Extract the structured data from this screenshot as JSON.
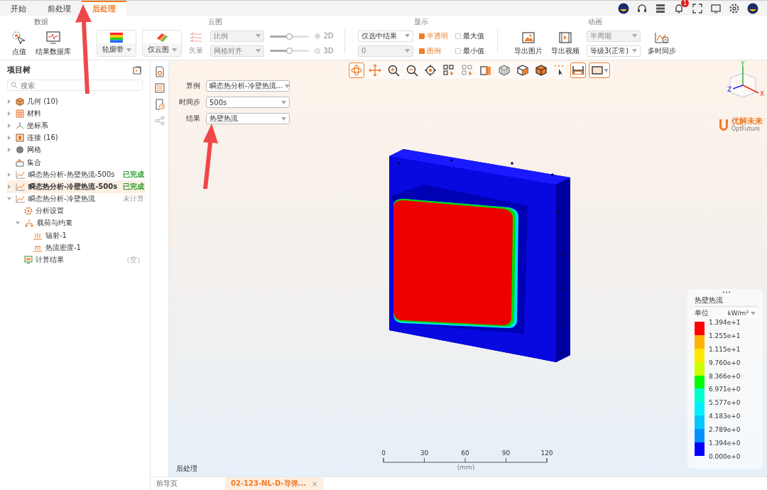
{
  "top_tabs": [
    {
      "label": "开始",
      "selected": false
    },
    {
      "label": "前处理",
      "selected": false
    },
    {
      "label": "后处理",
      "selected": true
    }
  ],
  "notification_count": "1",
  "ribbon": {
    "data": {
      "title": "数据",
      "buttons": [
        {
          "label": "点值"
        },
        {
          "label": "结果数据库"
        }
      ]
    },
    "contour": {
      "title": "云图",
      "band": "轮廓带",
      "cloud": "仅云图",
      "vector": {
        "label": "矢量",
        "disabled": true
      },
      "selects": [
        {
          "value": "比例",
          "disabled": true
        },
        {
          "value": "网格对齐",
          "disabled": true
        }
      ],
      "sliders": [
        {
          "level": 0.48
        },
        {
          "level": 0.48
        }
      ],
      "radios": [
        {
          "label": "2D",
          "selected": true
        },
        {
          "label": "3D",
          "selected": false
        }
      ]
    },
    "display": {
      "title": "显示",
      "selects": [
        {
          "value": "仅选中结果",
          "disabled": false
        },
        {
          "value": "0",
          "disabled": true
        }
      ],
      "checks": [
        {
          "label": "半透明",
          "checked": true
        },
        {
          "label": "最大值",
          "checked": false
        },
        {
          "label": "图例",
          "checked": true
        },
        {
          "label": "最小值",
          "checked": false
        }
      ]
    },
    "animation": {
      "title": "动画",
      "buttons": [
        {
          "label": "导出图片"
        },
        {
          "label": "导出视频"
        }
      ],
      "selects": [
        {
          "value": "半周期",
          "disabled": true
        },
        {
          "value": "等级3(正常)",
          "disabled": false
        }
      ],
      "sync": "多时同步"
    }
  },
  "project_tree": {
    "title": "项目树",
    "search": {
      "placeholder": "搜索"
    },
    "items": [
      {
        "kind": "geometry",
        "label": "几何 (10)",
        "expanded": false,
        "selected": false
      },
      {
        "kind": "material",
        "label": "材料",
        "expanded": false,
        "selected": false
      },
      {
        "kind": "coord",
        "label": "坐标系",
        "expanded": false,
        "selected": false
      },
      {
        "kind": "connection",
        "label": "连接 (16)",
        "expanded": false,
        "selected": false
      },
      {
        "kind": "mesh",
        "label": "网格",
        "expanded": false,
        "selected": false
      },
      {
        "kind": "set",
        "label": "集合",
        "selected": false
      },
      {
        "kind": "analysis",
        "label": "瞬态热分析-热壁热流-500s",
        "status": "已完成",
        "done": true,
        "expanded": false,
        "selected": false
      },
      {
        "kind": "analysis",
        "label": "瞬态热分析-冷壁热流-500s",
        "status": "已完成",
        "done": true,
        "expanded": false,
        "selected": true
      },
      {
        "kind": "analysis",
        "label": "瞬态热分析-冷壁热流",
        "status": "未计算",
        "done": false,
        "expanded": true,
        "selected": false,
        "children": [
          {
            "kind": "settings",
            "label": "分析设置",
            "selected": false
          },
          {
            "kind": "loads",
            "label": "载荷与约束",
            "expanded": true,
            "selected": false,
            "children": [
              {
                "kind": "radiation",
                "label": "辐射-1",
                "selected": false
              },
              {
                "kind": "heatflux",
                "label": "热流密度-1",
                "selected": false
              }
            ]
          },
          {
            "kind": "result",
            "label": "计算结果",
            "status": "（空）",
            "done": false,
            "selected": false
          }
        ]
      }
    ]
  },
  "view_toolbar": [
    {
      "selected": true
    },
    {
      "selected": false
    },
    {
      "selected": false
    },
    {
      "selected": false
    },
    {
      "selected": false
    },
    {
      "selected": false
    },
    {
      "selected": false
    },
    {
      "selected": false
    },
    {
      "selected": false
    },
    {
      "selected": false
    },
    {
      "selected": false
    },
    {
      "selected": false
    },
    {
      "selected": true
    },
    {
      "selected": true
    }
  ],
  "result_form": [
    {
      "label": "算例",
      "value": "瞬态热分析-冷壁热流..."
    },
    {
      "label": "时间步",
      "value": "500s"
    },
    {
      "label": "结果",
      "value": "热壁热流"
    }
  ],
  "axes": {
    "x": "X",
    "y": "Y",
    "z": "Z"
  },
  "logo": {
    "name": "优解未来",
    "tagline": "OptFuture"
  },
  "legend": {
    "handle": "•••",
    "title": "热壁热流",
    "unit_label": "单位",
    "unit": "kW/m²",
    "levels": [
      "1.394e+1",
      "1.255e+1",
      "1.115e+1",
      "9.760e+0",
      "8.366e+0",
      "6.971e+0",
      "5.577e+0",
      "4.183e+0",
      "2.789e+0",
      "1.394e+0",
      "0.000e+0"
    ],
    "bands": [
      {
        "color": "#ff0000"
      },
      {
        "color": "#ffb400"
      },
      {
        "color": "#ffe800"
      },
      {
        "color": "#ccff00"
      },
      {
        "color": "#00ff00"
      },
      {
        "color": "#00ffcc"
      },
      {
        "color": "#00f0ff"
      },
      {
        "color": "#00c8ff"
      },
      {
        "color": "#0090ff"
      },
      {
        "color": "#0000ff"
      }
    ]
  },
  "scale_bar": {
    "ticks": [
      "0",
      "30",
      "60",
      "90",
      "120"
    ],
    "unit": "(mm)"
  },
  "view_label": "后处理",
  "bottom_tabs": [
    {
      "label": "前导页",
      "selected": false
    },
    {
      "label": "02-123-NL-D-导弹...",
      "selected": true,
      "close": "×"
    }
  ]
}
